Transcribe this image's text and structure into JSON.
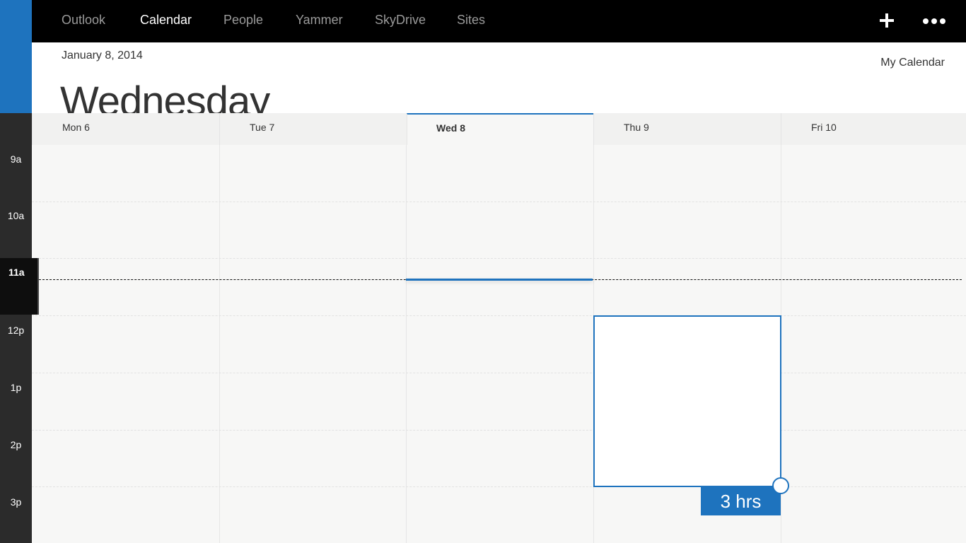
{
  "nav": {
    "items": [
      {
        "label": "Outlook",
        "active": false
      },
      {
        "label": "Calendar",
        "active": true
      },
      {
        "label": "People",
        "active": false
      },
      {
        "label": "Yammer",
        "active": false
      },
      {
        "label": "SkyDrive",
        "active": false
      },
      {
        "label": "Sites",
        "active": false
      }
    ],
    "add_icon": "plus-icon",
    "more_icon": "more-icon"
  },
  "header": {
    "date": "January 8, 2014",
    "day_name": "Wednesday",
    "calendar_name": "My Calendar"
  },
  "days": [
    {
      "label": "Mon 6",
      "today": false
    },
    {
      "label": "Tue 7",
      "today": false
    },
    {
      "label": "Wed 8",
      "today": true
    },
    {
      "label": "Thu 9",
      "today": false
    },
    {
      "label": "Fri 10",
      "today": false
    }
  ],
  "times": [
    {
      "label": "9a",
      "current": false
    },
    {
      "label": "10a",
      "current": false
    },
    {
      "label": "11a",
      "current": true
    },
    {
      "label": "12p",
      "current": false
    },
    {
      "label": "1p",
      "current": false
    },
    {
      "label": "2p",
      "current": false
    },
    {
      "label": "3p",
      "current": false
    }
  ],
  "new_event": {
    "day": "Thu 9",
    "start": "12p",
    "duration_label": "3 hrs"
  },
  "colors": {
    "accent": "#1e73be",
    "topbar": "#000000",
    "rail": "#2b2b2b"
  }
}
